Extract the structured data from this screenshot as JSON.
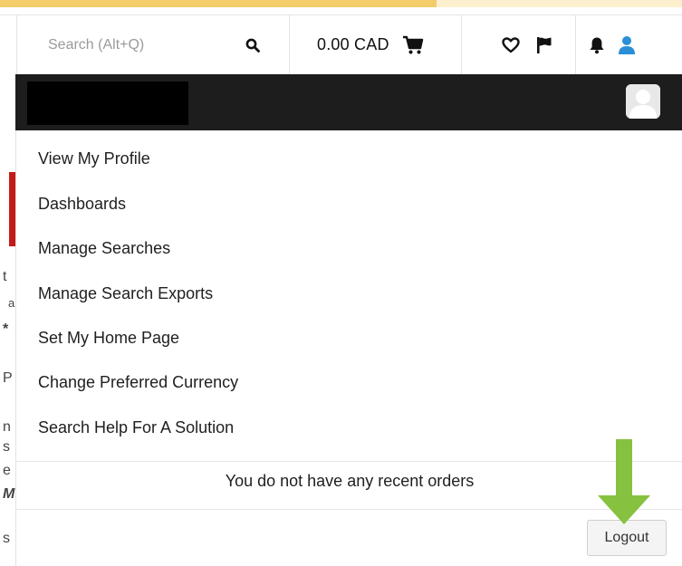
{
  "loading": {
    "progress": 0.64
  },
  "search": {
    "placeholder": "Search (Alt+Q)",
    "icon": "magnifier"
  },
  "cart": {
    "total": "0.00 CAD",
    "icon": "shopping-cart"
  },
  "header_icons": {
    "favorites": "heart-outline",
    "flag": "flag",
    "notifications": "bell",
    "user": "person"
  },
  "colors": {
    "accent_bar": "#f4cc6a",
    "user_bar": "#1d1d1d",
    "user_icon": "#2a8fd6",
    "red_block": "#c51a1a",
    "annotation_arrow": "#86c23f"
  },
  "menu": {
    "items": [
      "View My Profile",
      "Dashboards",
      "Manage Searches",
      "Manage Search Exports",
      "Set My Home Page",
      "Change Preferred Currency",
      "Search Help For A Solution"
    ]
  },
  "recent_orders": {
    "message": "You do not have any recent orders"
  },
  "logout": {
    "label": "Logout"
  },
  "background_fragments": [
    "t",
    "a",
    "*",
    "P",
    "n",
    "s",
    "e",
    "M",
    "s"
  ]
}
